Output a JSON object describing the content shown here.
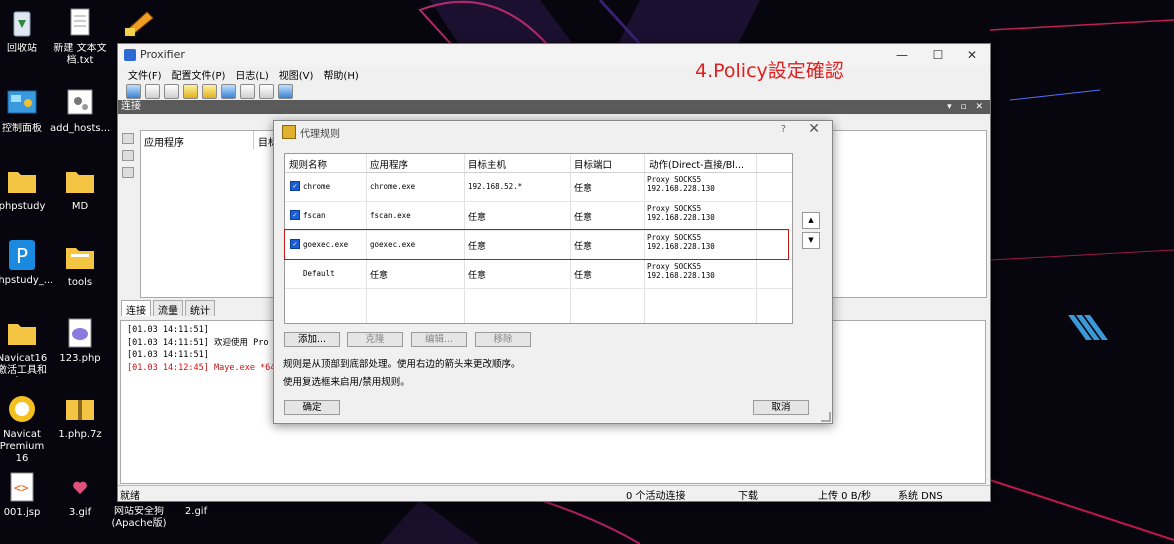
{
  "desktop": {
    "icons": [
      {
        "name": "recycle-bin",
        "label": "回收站"
      },
      {
        "name": "new-text-file",
        "label": "新建 文本文档.txt"
      },
      {
        "name": "app-shortcut",
        "label": ""
      },
      {
        "name": "control-panel",
        "label": "控制面板"
      },
      {
        "name": "add-hosts",
        "label": "add_hosts..."
      },
      {
        "name": "phpstudy-folder",
        "label": "phpstudy"
      },
      {
        "name": "md-folder",
        "label": "MD"
      },
      {
        "name": "phpstudy-shortcut",
        "label": "phpstudy_..."
      },
      {
        "name": "tools-folder",
        "label": "tools"
      },
      {
        "name": "navicat-tools",
        "label": "Navicat16激活工具和安..."
      },
      {
        "name": "php-file",
        "label": "123.php"
      },
      {
        "name": "navicat-premium",
        "label": "Navicat Premium 16"
      },
      {
        "name": "php-7z",
        "label": "1.php.7z"
      },
      {
        "name": "jsp-file",
        "label": "001.jsp"
      },
      {
        "name": "gif-3",
        "label": "3.gif"
      },
      {
        "name": "wangzhan",
        "label": "网站安全狗(Apache版)"
      },
      {
        "name": "gif-2",
        "label": "2.gif"
      }
    ]
  },
  "annotation": "4.Policy設定確認",
  "window": {
    "title": "Proxifier",
    "controls": {
      "minimize": "—",
      "maximize": "☐",
      "close": "✕"
    },
    "menu": [
      "文件(F)",
      "配置文件(P)",
      "日志(L)",
      "视图(V)",
      "帮助(H)"
    ],
    "panel_title": "连接",
    "panel_controls": "▾ ▫ ✕",
    "conn_columns": [
      "应用程序",
      "目标"
    ],
    "tabs": [
      "连接",
      "流量",
      "统计"
    ],
    "log": [
      {
        "text": "[01.03 14:11:51]",
        "style": "normal"
      },
      {
        "text": "[01.03 14:11:51]      欢迎使用 Pro",
        "style": "normal"
      },
      {
        "text": "[01.03 14:11:51]",
        "style": "normal"
      },
      {
        "text": "[01.03 14:12:45] Maye.exe *64 - ",
        "style": "red"
      }
    ],
    "status": {
      "ready": "就绪",
      "active": "0 个活动连接",
      "down": "下载",
      "up": "上传 0 B/秒",
      "dns": "系统 DNS"
    }
  },
  "dialog": {
    "title": "代理规则",
    "help": "?",
    "close": "✕",
    "columns": [
      "规则名称",
      "应用程序",
      "目标主机",
      "目标端口",
      "动作(Direct-直接/Bl..."
    ],
    "rules": [
      {
        "checked": true,
        "name": "chrome",
        "app": "chrome.exe",
        "host": "192.168.52.*",
        "port": "任意",
        "action1": "Proxy SOCKS5",
        "action2": "192.168.228.130"
      },
      {
        "checked": true,
        "name": "fscan",
        "app": "fscan.exe",
        "host": "任意",
        "port": "任意",
        "action1": "Proxy SOCKS5",
        "action2": "192.168.228.130"
      },
      {
        "checked": true,
        "name": "goexec.exe",
        "app": "goexec.exe",
        "host": "任意",
        "port": "任意",
        "action1": "Proxy SOCKS5",
        "action2": "192.168.228.130"
      },
      {
        "checked": false,
        "name": "Default",
        "app": "任意",
        "host": "任意",
        "port": "任意",
        "action1": "Proxy SOCKS5",
        "action2": "192.168.228.130"
      }
    ],
    "buttons": {
      "add": "添加...",
      "clone": "克隆",
      "edit": "编辑...",
      "remove": "移除",
      "ok": "确定",
      "cancel": "取消"
    },
    "hint1": "规则是从顶部到底部处理。使用右边的箭头来更改顺序。",
    "hint2": "使用复选框来启用/禁用规则。"
  }
}
